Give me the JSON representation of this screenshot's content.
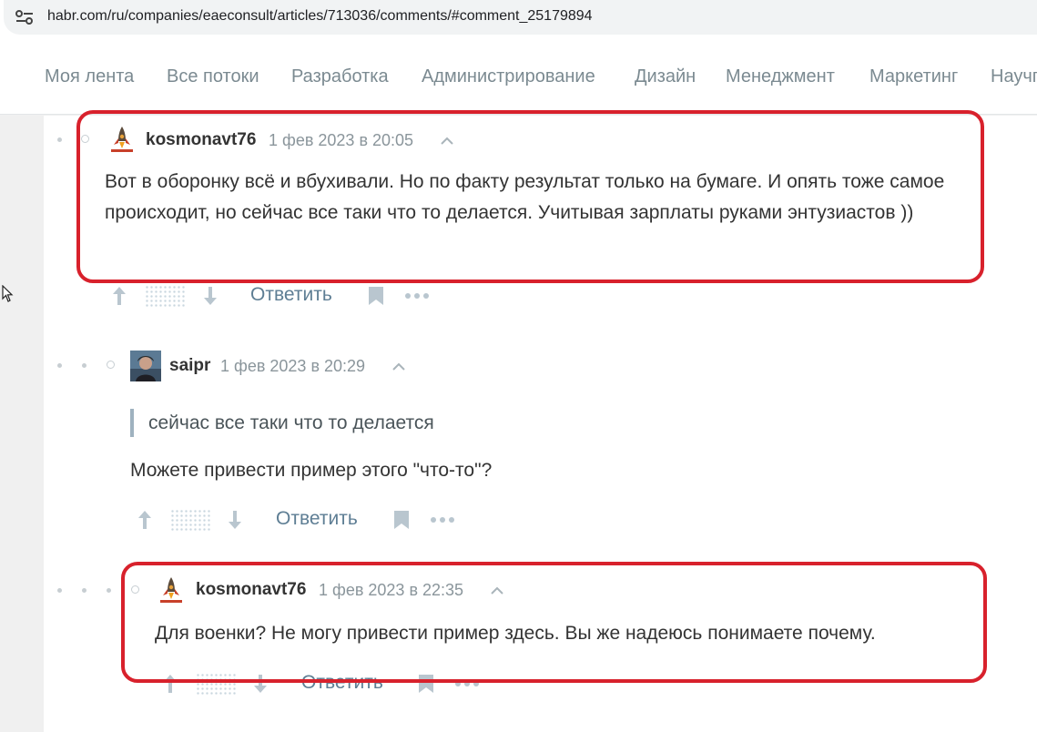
{
  "browser": {
    "url": "habr.com/ru/companies/eaeconsult/articles/713036/comments/#comment_25179894"
  },
  "nav": {
    "tabs": [
      "Моя лента",
      "Все потоки",
      "Разработка",
      "Администрирование",
      "Дизайн",
      "Менеджмент",
      "Маркетинг",
      "Научпоп"
    ]
  },
  "comments": [
    {
      "author": "kosmonavt76",
      "time": "1 фев 2023 в 20:05",
      "text": "Вот в оборонку всё и вбухивали. Но по факту результат только на бумаге. И опять тоже самое происходит, но сейчас все таки что то делается. Учитывая зарплаты руками энтузиастов ))",
      "reply_label": "Ответить",
      "highlighted": true
    },
    {
      "author": "saipr",
      "time": "1 фев 2023 в 20:29",
      "quote": "сейчас все таки что то делается",
      "text": "Можете привести пример этого \"что-то\"?",
      "reply_label": "Ответить",
      "highlighted": false
    },
    {
      "author": "kosmonavt76",
      "time": "1 фев 2023 в 22:35",
      "text": "Для военки? Не могу привести пример здесь. Вы же надеюсь понимаете почему.",
      "reply_label": "Ответить",
      "highlighted": true
    }
  ],
  "icons": {
    "upvote": "arrow-up-icon",
    "downvote": "arrow-down-icon",
    "bookmark": "bookmark-icon",
    "more": "more-dots-icon",
    "collapse": "chevron-up-icon",
    "site_info": "tune-icon"
  },
  "colors": {
    "highlight": "#d8212c",
    "link": "#5e7e94",
    "muted": "#8a959b"
  }
}
